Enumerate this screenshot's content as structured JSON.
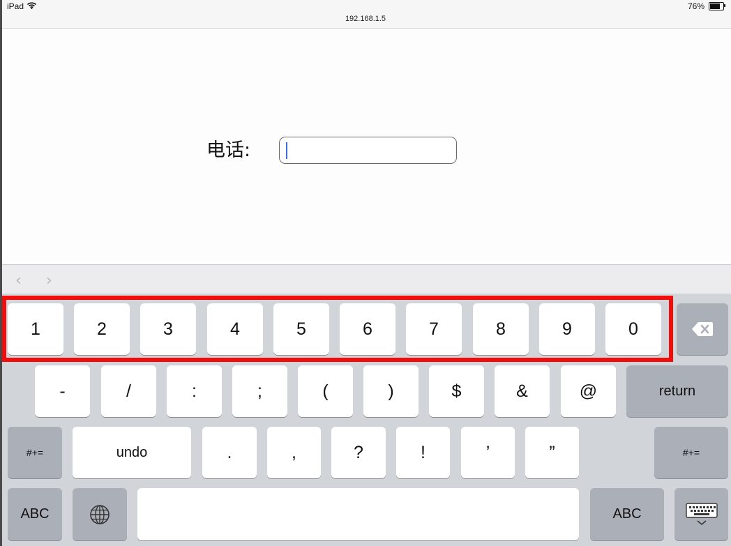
{
  "status_bar": {
    "device": "iPad",
    "battery": "76%",
    "battery_fraction": 0.76,
    "wifi_icon": "wifi-icon"
  },
  "browser": {
    "url": "192.168.1.5"
  },
  "form": {
    "phone_label": "电话:",
    "phone_value": ""
  },
  "accessory": {
    "prev_icon": "chevron-left-icon",
    "next_icon": "chevron-right-icon"
  },
  "keyboard": {
    "row1": [
      "1",
      "2",
      "3",
      "4",
      "5",
      "6",
      "7",
      "8",
      "9",
      "0"
    ],
    "row2": [
      "-",
      "/",
      ":",
      ";",
      "(",
      ")",
      "$",
      "&",
      "@"
    ],
    "row3": [
      ".",
      ",",
      "?",
      "!",
      "’",
      "”"
    ],
    "return_label": "return",
    "symbols_label": "#+=",
    "undo_label": "undo",
    "abc_label": "ABC",
    "delete_icon": "backspace-icon",
    "globe_icon": "globe-icon",
    "hide_keyboard_icon": "keyboard-dismiss-icon"
  },
  "colors": {
    "highlight": "#f20d0d",
    "caret": "#3b6fe0",
    "keyboard_bg": "#d1d4d9"
  }
}
